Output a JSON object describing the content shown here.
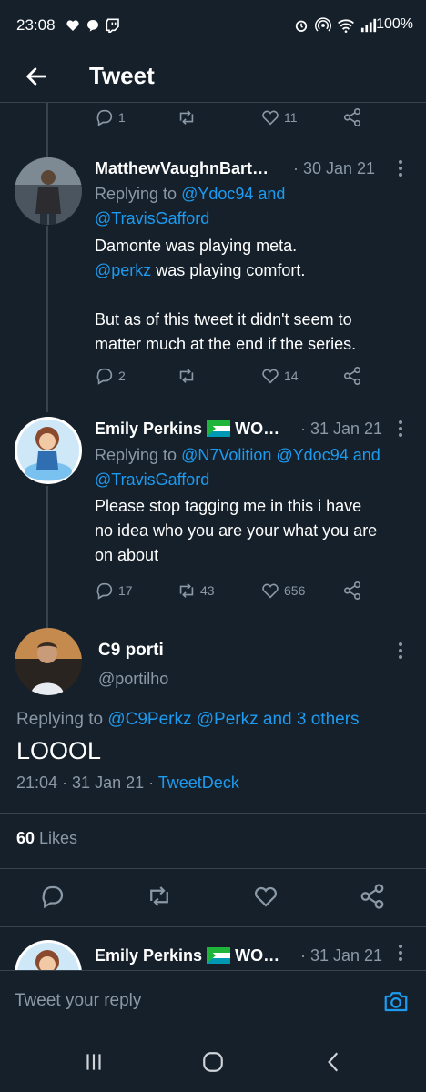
{
  "status_bar": {
    "time": "23:08",
    "battery": "100%"
  },
  "header": {
    "title": "Tweet"
  },
  "top_actions": {
    "replies": "1",
    "likes": "11"
  },
  "tweets": [
    {
      "name": "MatthewVaughnBart…",
      "date": "· 30 Jan 21",
      "replying_prefix": "Replying to ",
      "replying_line1": "@Ydoc94 and",
      "replying_line2": "@TravisGafford",
      "text_line1": "Damonte was playing meta.",
      "text_mention": "@perkz",
      "text_line2_rest": " was playing comfort.",
      "text_line3": "But as of this tweet it didn't seem to",
      "text_line4": "matter much at the end if the series.",
      "replies": "2",
      "retweets": "",
      "likes": "14"
    },
    {
      "name": "Emily Perkins",
      "name_suffix": "WO…",
      "date": "· 31 Jan 21",
      "replying_prefix": "Replying to ",
      "replying_line1": "@N7Volition @Ydoc94 and",
      "replying_line2": "@TravisGafford",
      "text_line1": "Please stop tagging me in this i have",
      "text_line2": "no idea who you are your what you are",
      "text_line3": "on about",
      "replies": "17",
      "retweets": "43",
      "likes": "656"
    }
  ],
  "main_tweet": {
    "name": "C9 porti",
    "handle": "@portilho",
    "replying_prefix": "Replying to ",
    "replying_to": "@C9Perkz @Perkz and 3 others",
    "text": "LOOOL",
    "time": "21:04 · 31 Jan 21 · ",
    "source": "TweetDeck",
    "likes_count": "60",
    "likes_label": " Likes"
  },
  "next_tweet": {
    "name": "Emily Perkins",
    "name_suffix": "WO…",
    "date": "· 31 Jan 21"
  },
  "reply_bar": {
    "placeholder": "Tweet your reply"
  },
  "colors": {
    "background": "#15202b",
    "accent": "#1d9bf0",
    "muted": "#8b98a5",
    "divider": "#38444d"
  }
}
